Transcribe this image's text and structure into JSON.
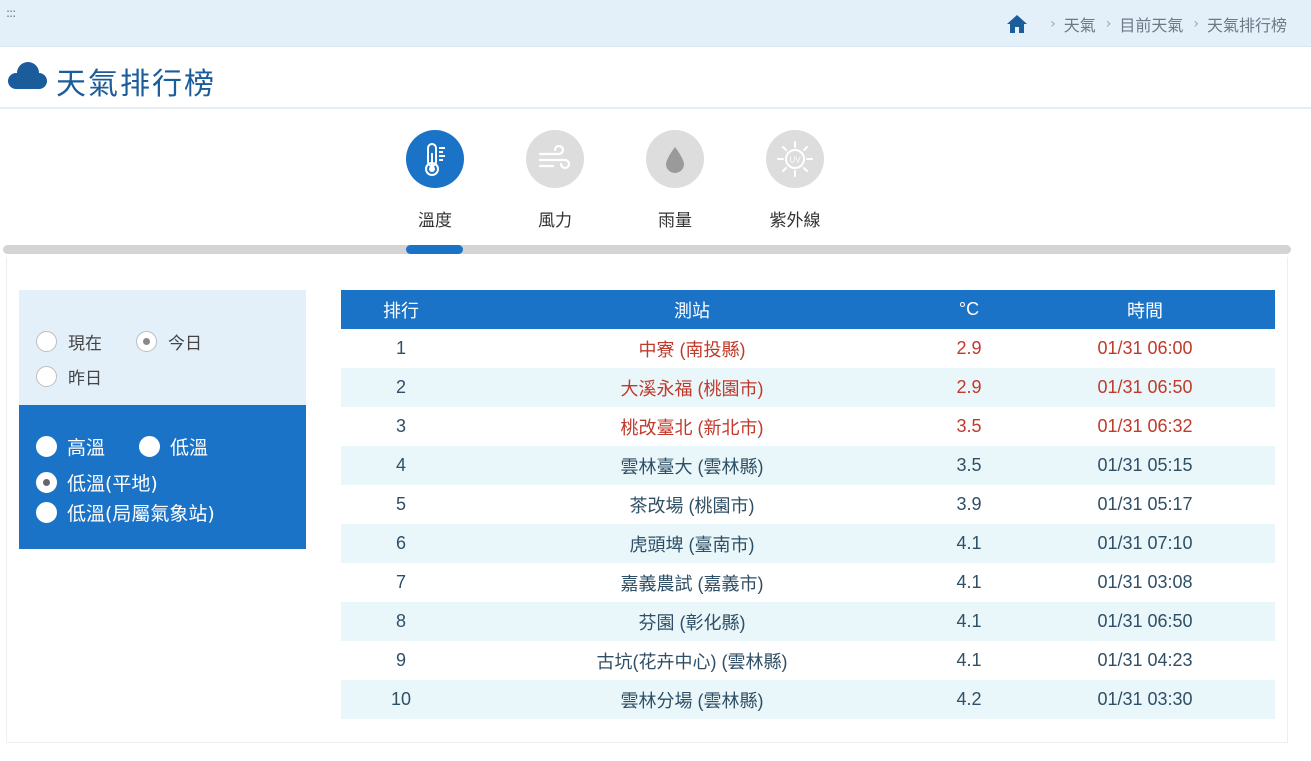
{
  "breadcrumb": {
    "dots": ":::",
    "items": [
      "天氣",
      "目前天氣",
      "天氣排行榜"
    ]
  },
  "page": {
    "title": "天氣排行榜"
  },
  "tabs": [
    {
      "label": "溫度",
      "icon": "thermometer-icon",
      "active": true
    },
    {
      "label": "風力",
      "icon": "wind-icon",
      "active": false
    },
    {
      "label": "雨量",
      "icon": "raindrop-icon",
      "active": false
    },
    {
      "label": "紫外線",
      "icon": "uv-sun-icon",
      "active": false
    }
  ],
  "filters": {
    "period": [
      {
        "label": "現在",
        "selected": false
      },
      {
        "label": "今日",
        "selected": true
      },
      {
        "label": "昨日",
        "selected": false
      }
    ],
    "type": [
      {
        "label": "高溫",
        "selected": false
      },
      {
        "label": "低溫",
        "selected": false
      },
      {
        "label": "低溫(平地)",
        "selected": true
      },
      {
        "label": "低溫(局屬氣象站)",
        "selected": false
      }
    ]
  },
  "table": {
    "headers": [
      "排行",
      "測站",
      "°C",
      "時間"
    ],
    "rows": [
      {
        "rank": "1",
        "station": "中寮 (南投縣)",
        "temp": "2.9",
        "time": "01/31 06:00",
        "highlight": true
      },
      {
        "rank": "2",
        "station": "大溪永福 (桃園市)",
        "temp": "2.9",
        "time": "01/31 06:50",
        "highlight": true
      },
      {
        "rank": "3",
        "station": "桃改臺北 (新北市)",
        "temp": "3.5",
        "time": "01/31 06:32",
        "highlight": true
      },
      {
        "rank": "4",
        "station": "雲林臺大 (雲林縣)",
        "temp": "3.5",
        "time": "01/31 05:15",
        "highlight": false
      },
      {
        "rank": "5",
        "station": "茶改場 (桃園市)",
        "temp": "3.9",
        "time": "01/31 05:17",
        "highlight": false
      },
      {
        "rank": "6",
        "station": "虎頭埤 (臺南市)",
        "temp": "4.1",
        "time": "01/31 07:10",
        "highlight": false
      },
      {
        "rank": "7",
        "station": "嘉義農試 (嘉義市)",
        "temp": "4.1",
        "time": "01/31 03:08",
        "highlight": false
      },
      {
        "rank": "8",
        "station": "芬園 (彰化縣)",
        "temp": "4.1",
        "time": "01/31 06:50",
        "highlight": false
      },
      {
        "rank": "9",
        "station": "古坑(花卉中心) (雲林縣)",
        "temp": "4.1",
        "time": "01/31 04:23",
        "highlight": false
      },
      {
        "rank": "10",
        "station": "雲林分場 (雲林縣)",
        "temp": "4.2",
        "time": "01/31 03:30",
        "highlight": false
      }
    ]
  },
  "colors": {
    "accent": "#1a73c7",
    "highlight_text": "#c0392b",
    "row_stripe": "#eaf7fa",
    "filter_light": "#e3f0fa"
  }
}
